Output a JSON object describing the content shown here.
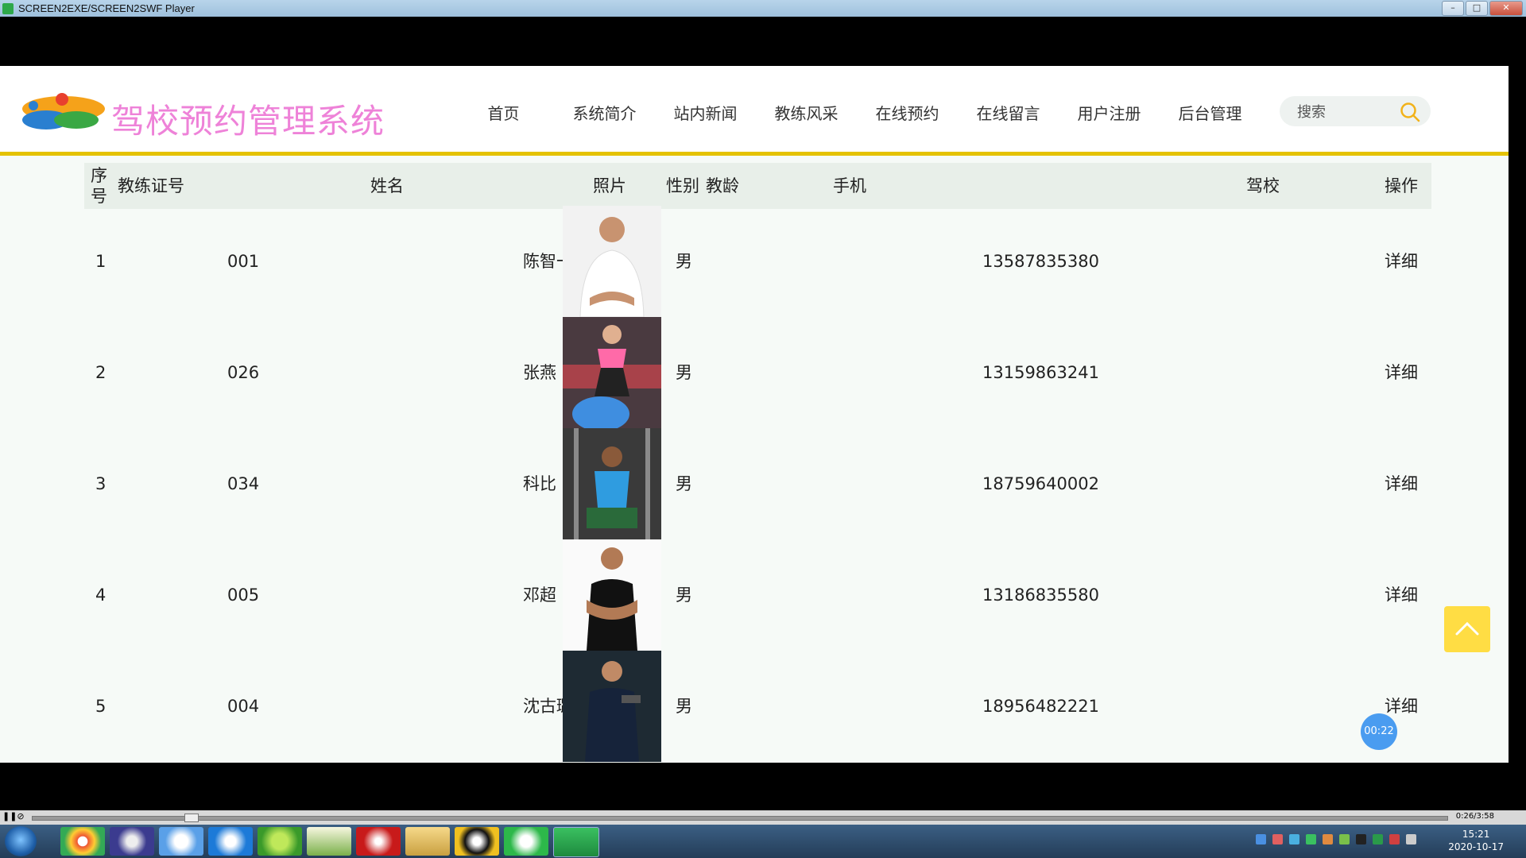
{
  "window": {
    "title": "SCREEN2EXE/SCREEN2SWF Player"
  },
  "site": {
    "title": "驾校预约管理系统"
  },
  "nav": [
    {
      "label": "首页"
    },
    {
      "label": "系统简介"
    },
    {
      "label": "站内新闻"
    },
    {
      "label": "教练风采"
    },
    {
      "label": "在线预约"
    },
    {
      "label": "在线留言"
    },
    {
      "label": "用户注册"
    },
    {
      "label": "后台管理"
    }
  ],
  "search": {
    "placeholder": "搜索"
  },
  "table": {
    "headers": {
      "seq": "序号",
      "coach_id": "教练证号",
      "name": "姓名",
      "photo": "照片",
      "gender": "性别",
      "experience": "教龄",
      "phone": "手机",
      "school": "驾校",
      "action": "操作"
    },
    "rows": [
      {
        "seq": "1",
        "coach_id": "001",
        "name": "陈智一",
        "gender": "男",
        "phone": "13587835380",
        "action": "详细"
      },
      {
        "seq": "2",
        "coach_id": "026",
        "name": "张燕",
        "gender": "男",
        "phone": "13159863241",
        "action": "详细"
      },
      {
        "seq": "3",
        "coach_id": "034",
        "name": "科比",
        "gender": "男",
        "phone": "18759640002",
        "action": "详细"
      },
      {
        "seq": "4",
        "coach_id": "005",
        "name": "邓超",
        "gender": "男",
        "phone": "13186835580",
        "action": "详细"
      },
      {
        "seq": "5",
        "coach_id": "004",
        "name": "沈古璐",
        "gender": "男",
        "phone": "18956482221",
        "action": "详细"
      }
    ]
  },
  "widgets": {
    "timer": "00:22"
  },
  "player": {
    "time": "0:26/3:58"
  },
  "taskbar": {
    "time": "15:21",
    "date": "2020-10-17"
  },
  "colors": {
    "accent": "#e4c200",
    "title_pink": "#ee82d8",
    "backtop": "#ffdd44",
    "timer": "#4a9cf0"
  }
}
